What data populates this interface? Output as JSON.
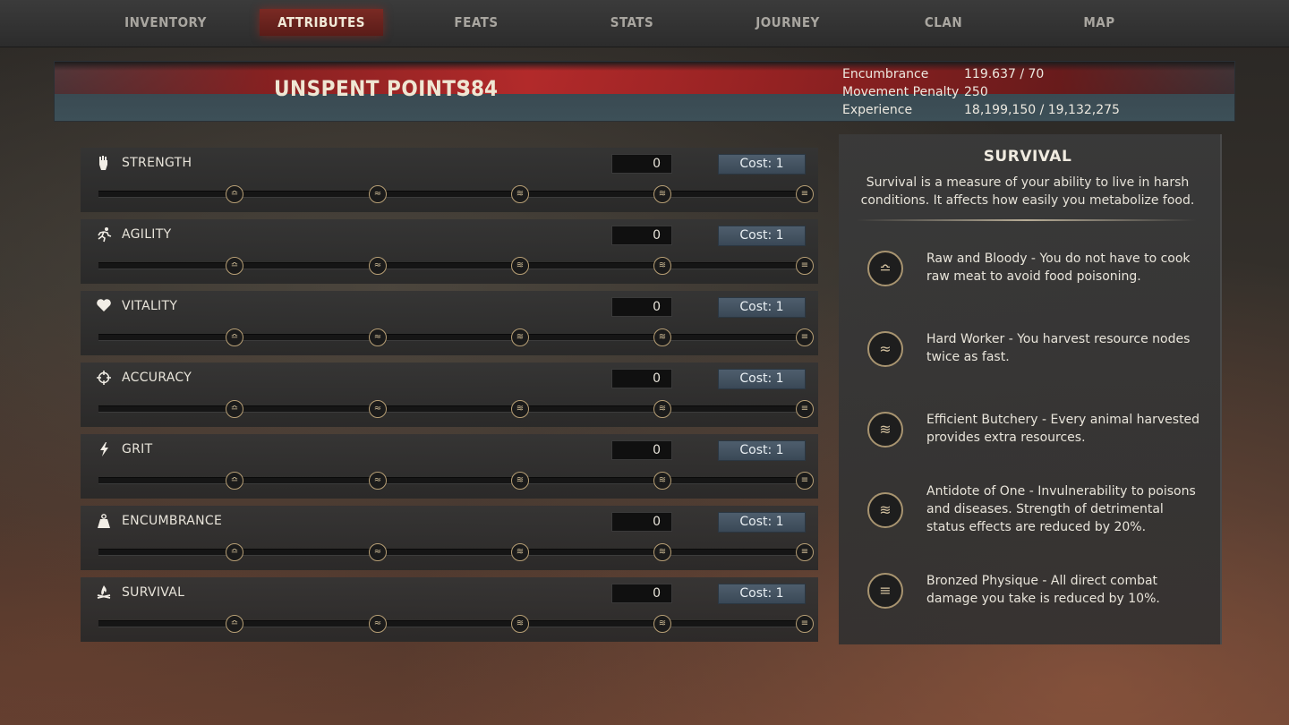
{
  "tabs": [
    {
      "label": "INVENTORY"
    },
    {
      "label": "ATTRIBUTES"
    },
    {
      "label": "FEATS"
    },
    {
      "label": "STATS"
    },
    {
      "label": "JOURNEY"
    },
    {
      "label": "CLAN"
    },
    {
      "label": "MAP"
    }
  ],
  "active_tab": "ATTRIBUTES",
  "banner": {
    "unspent_label": "UNSPENT POINTS",
    "unspent_value": "384",
    "stats": [
      {
        "label": "Encumbrance",
        "value": "119.637 / 70"
      },
      {
        "label": "Movement Penalty",
        "value": "250"
      },
      {
        "label": "Experience",
        "value": "18,199,150 / 19,132,275"
      }
    ]
  },
  "attributes": [
    {
      "name": "STRENGTH",
      "icon": "fist-icon",
      "value": "0",
      "cost": "Cost: 1"
    },
    {
      "name": "AGILITY",
      "icon": "running-icon",
      "value": "0",
      "cost": "Cost: 1"
    },
    {
      "name": "VITALITY",
      "icon": "heart-icon",
      "value": "0",
      "cost": "Cost: 1"
    },
    {
      "name": "ACCURACY",
      "icon": "crosshair-icon",
      "value": "0",
      "cost": "Cost: 1"
    },
    {
      "name": "GRIT",
      "icon": "lightning-icon",
      "value": "0",
      "cost": "Cost: 1"
    },
    {
      "name": "ENCUMBRANCE",
      "icon": "weight-icon",
      "value": "0",
      "cost": "Cost: 1"
    },
    {
      "name": "SURVIVAL",
      "icon": "campfire-icon",
      "value": "0",
      "cost": "Cost: 1"
    }
  ],
  "node_glyphs": [
    "≏",
    "≈",
    "≋",
    "≋",
    "≡"
  ],
  "panel": {
    "title": "SURVIVAL",
    "description": "Survival is a measure of your ability to live in harsh conditions. It affects how easily you metabolize food.",
    "perks": [
      {
        "glyph": "≏",
        "text": "Raw and Bloody - You do not have to cook raw meat to avoid food poisoning."
      },
      {
        "glyph": "≈",
        "text": "Hard Worker - You harvest resource nodes twice as fast."
      },
      {
        "glyph": "≋",
        "text": "Efficient Butchery - Every animal harvested provides extra resources."
      },
      {
        "glyph": "≋",
        "text": "Antidote of One - Invulnerability to poisons and diseases. Strength of detrimental status effects are reduced by 20%."
      },
      {
        "glyph": "≡",
        "text": "Bronzed Physique - All direct combat damage you take is reduced by 10%."
      }
    ]
  },
  "colors": {
    "accent_red": "#8a1e1e",
    "node_border": "#b79f75",
    "cost_button": "#4e5e6d"
  }
}
